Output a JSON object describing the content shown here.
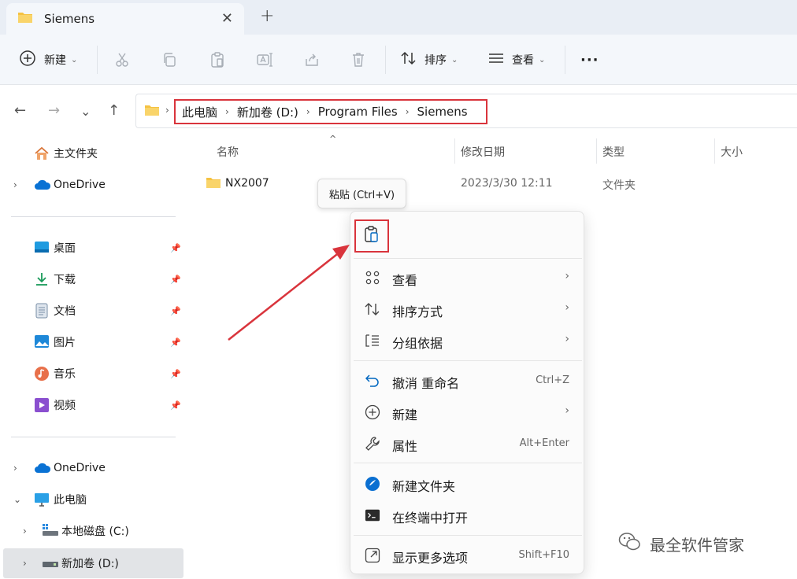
{
  "tab": {
    "title": "Siemens",
    "close": "✕",
    "new": "+"
  },
  "toolbar": {
    "new_label": "新建",
    "sort_label": "排序",
    "view_label": "查看",
    "more": "···",
    "chevron": "⌄"
  },
  "nav": {
    "back": "←",
    "forward": "→",
    "recent": "⌄",
    "up": "↑",
    "breadcrumb": [
      "此电脑",
      "新加卷 (D:)",
      "Program Files",
      "Siemens"
    ],
    "sep": "›"
  },
  "sidebar": {
    "home": "主文件夹",
    "onedrive_top": "OneDrive",
    "quick": [
      "桌面",
      "下载",
      "文档",
      "图片",
      "音乐",
      "视频"
    ],
    "onedrive": "OneDrive",
    "thispc": "此电脑",
    "drive_c": "本地磁盘 (C:)",
    "drive_d": "新加卷 (D:)",
    "expand": "›",
    "expanded": "⌄"
  },
  "columns": {
    "name": "名称",
    "date": "修改日期",
    "type": "类型",
    "size": "大小",
    "sort_caret": "^"
  },
  "files": [
    {
      "name": "NX2007",
      "date": "2023/3/30 12:11",
      "type": "文件夹"
    }
  ],
  "tooltip": "粘贴 (Ctrl+V)",
  "context_menu": {
    "items": [
      {
        "label": "查看",
        "icon": "grid-icon",
        "arrow": "›"
      },
      {
        "label": "排序方式",
        "icon": "sort-icon",
        "arrow": "›"
      },
      {
        "label": "分组依据",
        "icon": "group-icon",
        "arrow": "›"
      },
      {
        "label": "撤消 重命名",
        "icon": "undo-icon",
        "key": "Ctrl+Z"
      },
      {
        "label": "新建",
        "icon": "add-icon",
        "arrow": "›"
      },
      {
        "label": "属性",
        "icon": "wrench-icon",
        "key": "Alt+Enter"
      },
      {
        "label": "新建文件夹",
        "icon": "new-folder-icon"
      },
      {
        "label": "在终端中打开",
        "icon": "terminal-icon"
      },
      {
        "label": "显示更多选项",
        "icon": "more-options-icon",
        "key": "Shift+F10"
      }
    ]
  },
  "watermark": "最全软件管家",
  "colors": {
    "highlight": "#d9343c",
    "folder": "#f5c242",
    "accent": "#0067c0"
  }
}
